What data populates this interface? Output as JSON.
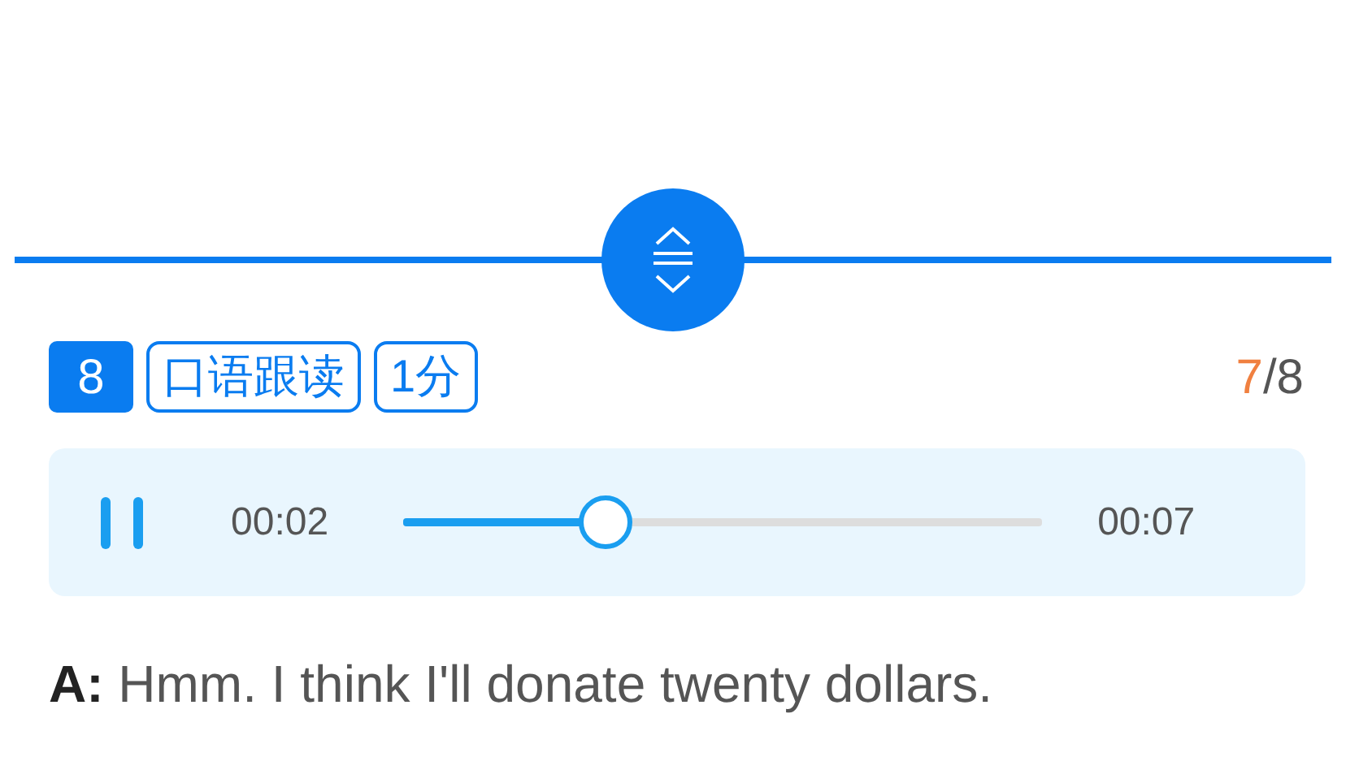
{
  "question": {
    "number": "8",
    "tags": [
      "口语跟读",
      "1分"
    ],
    "progress": {
      "current": "7",
      "total": "/8"
    }
  },
  "player": {
    "playing": true,
    "elapsed": "00:02",
    "duration": "00:07",
    "level": 0.315
  },
  "sentence": "**A:** Hmm. I think I'll donate twenty dollars."
}
